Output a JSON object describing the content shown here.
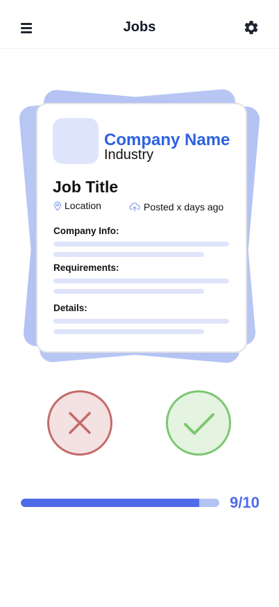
{
  "header": {
    "title": "Jobs",
    "menu_icon": "hamburger-menu-icon",
    "settings_icon": "gear-icon"
  },
  "job_card": {
    "company_name": "Company Name",
    "industry": "Industry",
    "job_title": "Job Title",
    "location": "Location",
    "location_icon": "map-pin-icon",
    "posted": "Posted x days ago",
    "posted_icon": "cloud-upload-icon",
    "sections": [
      {
        "label": "Company Info:"
      },
      {
        "label": "Requirements:"
      },
      {
        "label": "Details:"
      }
    ]
  },
  "actions": {
    "reject_icon": "x-icon",
    "accept_icon": "check-icon"
  },
  "progress": {
    "current": 9,
    "total": 10,
    "label": "9/10",
    "fraction": 0.9
  },
  "colors": {
    "accent": "#4f6be8",
    "company_name": "#2d62e0",
    "card_back": "#b4c3f3",
    "reject_border": "#c46a6a",
    "reject_fill": "#f4e1e1",
    "accept_border": "#7cc771",
    "accept_fill": "#e4f4e1"
  }
}
